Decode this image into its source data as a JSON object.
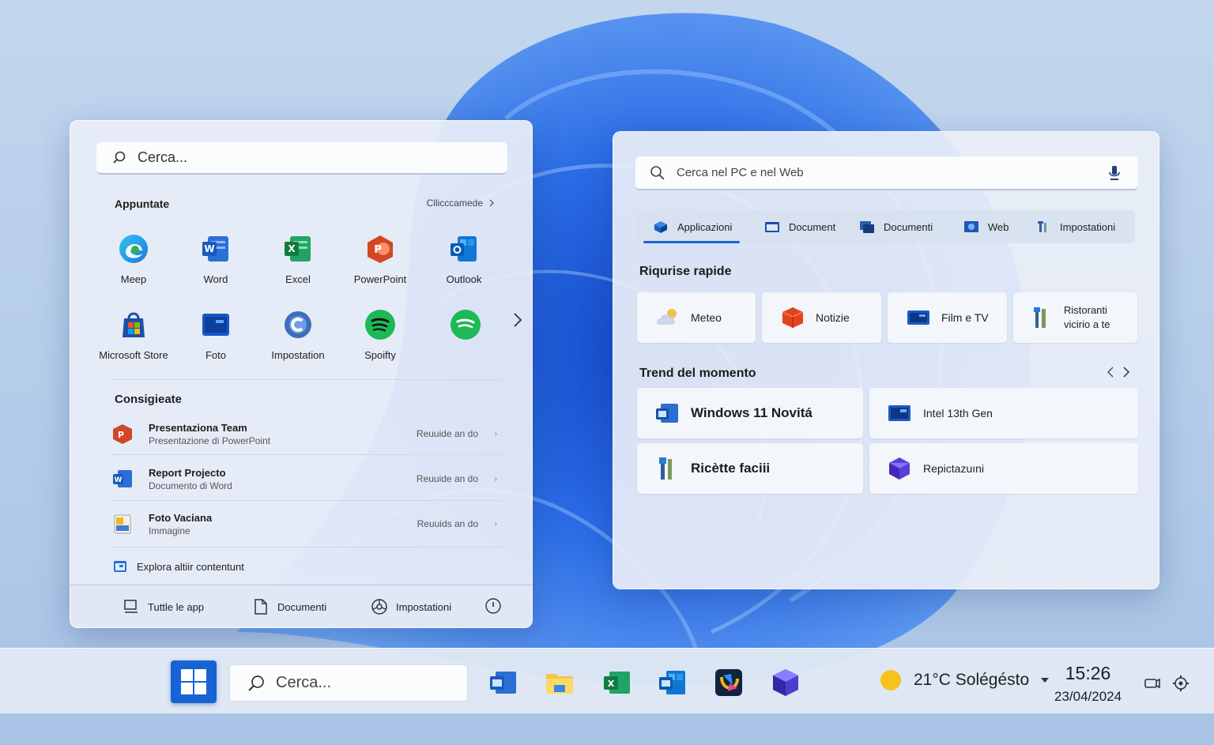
{
  "start_menu": {
    "search_placeholder": "Cerca...",
    "pinned_title": "Appuntate",
    "see_all_label": "Cllicccamede",
    "pinned_apps": [
      {
        "label": "Meep",
        "icon": "edge-icon"
      },
      {
        "label": "Word",
        "icon": "word-icon"
      },
      {
        "label": "Excel",
        "icon": "excel-icon"
      },
      {
        "label": "PowerPoint",
        "icon": "powerpoint-icon"
      },
      {
        "label": "Outlook",
        "icon": "outlook-icon"
      },
      {
        "label": "Microsoft Store",
        "icon": "store-icon"
      },
      {
        "label": "Foto",
        "icon": "photos-icon"
      },
      {
        "label": "Impostation",
        "icon": "settings-app-icon"
      },
      {
        "label": "Spoifty",
        "icon": "spotify-icon"
      },
      {
        "label": "",
        "icon": "spotify-icon"
      }
    ],
    "recommended_title": "Consigieate",
    "recommended": [
      {
        "title": "Presentaziona Team",
        "subtitle": "Presentazione di PowerPoint",
        "time": "Reuuide an do",
        "icon": "powerpoint-icon"
      },
      {
        "title": "Report Projecto",
        "subtitle": "Documento di Word",
        "time": "Reuuide an do",
        "icon": "word-icon"
      },
      {
        "title": "Foto Vaciana",
        "subtitle": "Immagine",
        "time": "Reuuids an do",
        "icon": "image-icon"
      }
    ],
    "explore_label": "Explora altiir contentunt",
    "footer": {
      "all_apps": "Tuttle le app",
      "documents": "Documenti",
      "settings": "Impostationi"
    }
  },
  "search_panel": {
    "search_placeholder": "Cerca nel PC e nel Web",
    "tabs": [
      {
        "label": "Applicazioni",
        "active": true
      },
      {
        "label": "Document",
        "active": false
      },
      {
        "label": "Documenti",
        "active": false
      },
      {
        "label": "Web",
        "active": false
      },
      {
        "label": "Impostationi",
        "active": false
      }
    ],
    "quick_title": "Riqurise rapide",
    "quick": [
      {
        "label": "Meteo",
        "icon": "cloud-icon"
      },
      {
        "label": "Notizie",
        "icon": "news-cube-icon"
      },
      {
        "label": "Film e TV",
        "icon": "film-icon"
      },
      {
        "label": "Ristoranti vicirio a te",
        "line1": "Ristoranti",
        "line2": "vicirio a te",
        "icon": "restaurant-icon"
      }
    ],
    "trend_title": "Trend del momento",
    "trends": [
      {
        "label": "Windows 11 Novitá",
        "icon": "windows-doc-icon"
      },
      {
        "label": "Intel 13th Gen",
        "icon": "monitor-icon"
      },
      {
        "label": "Ricètte faciii",
        "icon": "utensils-icon"
      },
      {
        "label": "Repictazuıni",
        "icon": "purple-cube-icon"
      }
    ]
  },
  "taskbar": {
    "search_placeholder": "Cerca...",
    "apps": [
      "word-icon",
      "file-explorer-icon",
      "excel-icon",
      "outlook-icon",
      "store-icon",
      "cube-icon"
    ],
    "weather": "21°C Solégésto",
    "time": "15:26",
    "date": "23/04/2024"
  },
  "colors": {
    "accent": "#1a66d2",
    "start_button": "#1664d4"
  }
}
